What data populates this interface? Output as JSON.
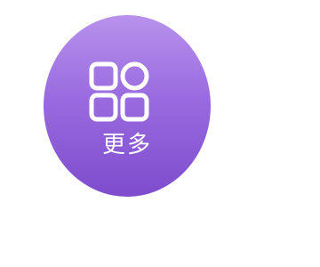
{
  "more_button": {
    "label": "更多",
    "icon": "grid-four-icon"
  },
  "colors": {
    "gradient_top": "#b892ec",
    "gradient_mid": "#9a6be0",
    "gradient_bottom": "#7e4ccd",
    "foreground": "#ffffff",
    "background": "#ffffff"
  }
}
